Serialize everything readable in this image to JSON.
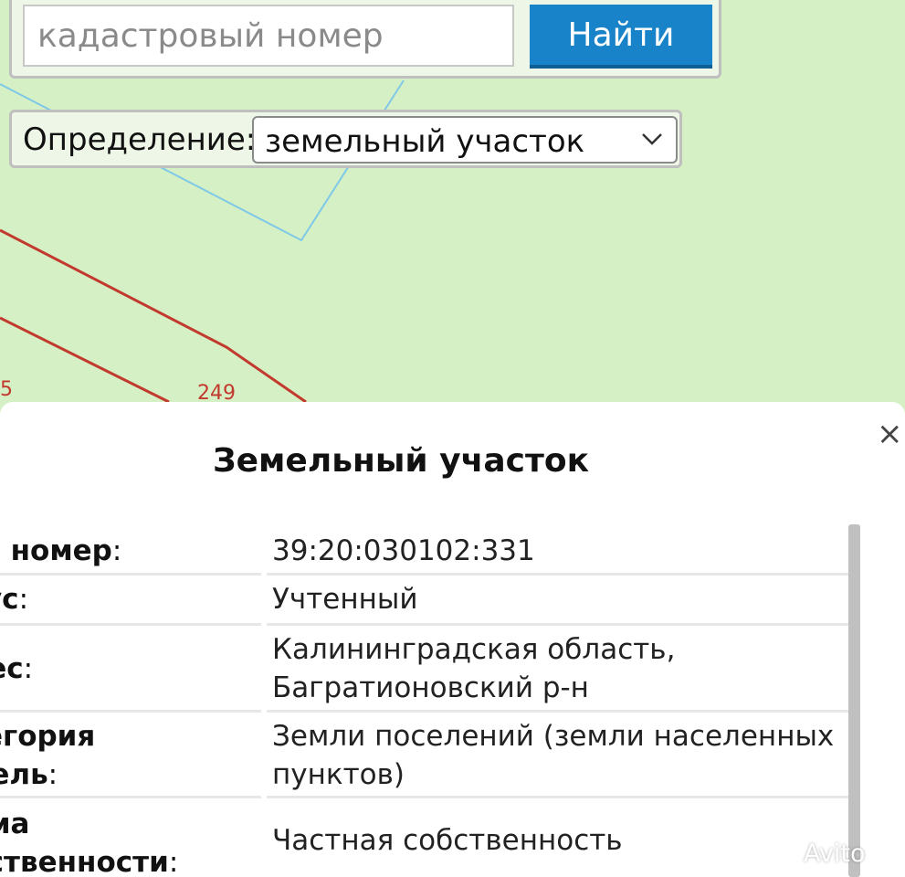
{
  "search": {
    "placeholder": "кадастровый номер",
    "button_label": "Найти"
  },
  "definition": {
    "label": "Определение:",
    "selected": "земельный участок"
  },
  "map": {
    "labels": [
      "5",
      "249"
    ]
  },
  "panel": {
    "title": "Земельный участок",
    "rows": [
      {
        "label": "д. номер",
        "value": "39:20:030102:331"
      },
      {
        "label": "тус",
        "value": "Учтенный"
      },
      {
        "label": "рес",
        "value": "Калининградская область,\nБагратионовский р-н"
      },
      {
        "label": "тегория\nмель",
        "value": "Земли поселений (земли населенных\nпунктов)"
      },
      {
        "label": "рма\nбственности",
        "value": "Частная собственность"
      }
    ]
  },
  "watermark": "Avito",
  "colors": {
    "map_background": "#d5f0c4",
    "parcel_line": "#c23a2e",
    "boundary_line": "#7fc8e8",
    "button": "#1883c9"
  }
}
